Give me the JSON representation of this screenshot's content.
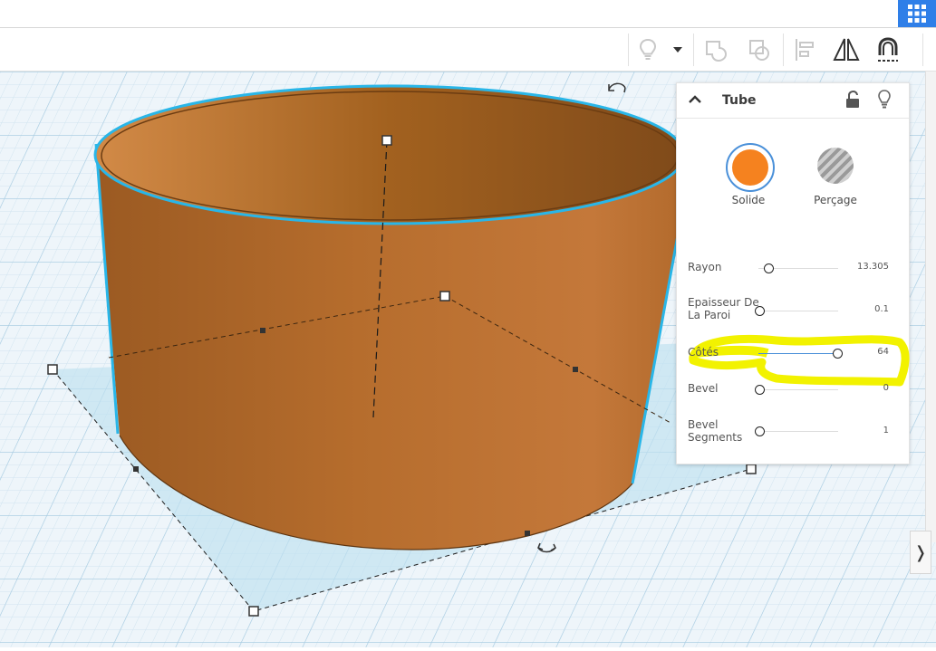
{
  "shape": {
    "name": "Tube",
    "solid_label": "Solide",
    "hole_label": "Perçage",
    "solid_color": "#f5821f"
  },
  "params": [
    {
      "label": "Rayon",
      "value": "13.305",
      "fill": 0.1
    },
    {
      "label": "Epaisseur De La Paroi",
      "value": "0.1",
      "fill": 0.0
    },
    {
      "label": "Côtés",
      "value": "64",
      "fill": 0.97
    },
    {
      "label": "Bevel",
      "value": "0",
      "fill": 0.0
    },
    {
      "label": "Bevel Segments",
      "value": "1",
      "fill": 0.0
    }
  ],
  "highlight": {
    "color": "#f2f200",
    "target": "Côtés"
  },
  "colors": {
    "accent": "#2f7fe8",
    "grid": "#cfe3ef",
    "selection": "#29b6e8"
  },
  "icons": [
    "grid-icon",
    "lightbulb-icon",
    "dropdown-icon",
    "group-icon",
    "ungroup-icon",
    "align-icon",
    "mirror-icon",
    "magnet-icon",
    "collapse-icon",
    "lock-icon",
    "rotate-icon",
    "expand-icon"
  ],
  "expand_label": "❭"
}
